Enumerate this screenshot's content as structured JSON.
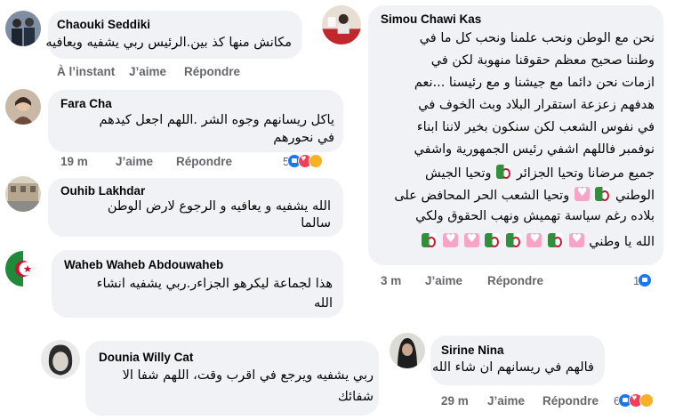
{
  "actions": {
    "like": "J’aime",
    "reply": "Répondre"
  },
  "comments": {
    "chaouki": {
      "author": "Chaouki Seddiki",
      "text": "مكانش منها كذ بين.الرئيس ربي يشفيه ويعافيه",
      "time": "À l’instant"
    },
    "fara": {
      "author": "Fara Cha",
      "lines": [
        "ياكل ريسانهم وجوه الشر .اللهم اجعل كيدهم",
        "في نحورهم"
      ],
      "time": "19 m",
      "reaction_count": "5",
      "reactions": [
        "like",
        "love",
        "care"
      ]
    },
    "ouhib": {
      "author": "Ouhib Lakhdar",
      "lines": [
        "الله يشفيه و يعافيه و الرجوع لارض الوطن",
        "سالما"
      ]
    },
    "waheb": {
      "author": "Waheb Waheb Abdouwaheb",
      "lines": [
        "هذا لجماعة  ليكرهو الجزاءر.ربي يشفيه انشاء",
        "الله"
      ]
    },
    "dounia": {
      "author": "Dounia Willy Cat",
      "lines": [
        "ربي يشفيه ويرجع في اقرب وقت، اللهم شفا الا",
        "شفائك"
      ]
    },
    "simou": {
      "author": "Simou Chawi Kas",
      "lines": [
        "نحن مع الوطن ونحب علمنا ونحب كل ما في",
        "وطننا صحيح معظم حقوقنا منهوبة لكن في",
        "ازمات نحن دائما مع جيشنا و مع رئيسنا ...نعم",
        "هدفهم زعزعة استقرار البلاد وبث الخوف في",
        "في نفوس الشعب لكن سنكون بخير لاننا ابناء",
        "نوفمبر فاللهم اشفي رئيس الجمهورية واشفي",
        "جميع مرضانا وتحيا الجزائر",
        "الوطني",
        "بلاده رغم سياسة تهميش ونهب الحقوق ولكي",
        "الله يا وطني"
      ],
      "line7_tail": "وتحيا الجيش",
      "line8_tail": "وتحيا الشعب الحر المحافض على",
      "time": "3 m",
      "reaction_count": "1",
      "reactions": [
        "like"
      ]
    },
    "sirine": {
      "author": "Sirine Nina",
      "text": "فالهم في ريسانهم ان شاء الله",
      "time": "29 m",
      "reaction_count": "6",
      "reactions": [
        "like",
        "love",
        "care"
      ]
    }
  },
  "colors": {
    "bubble": "#f0f2f5",
    "meta": "#65676b",
    "like_blue": "#1877f2",
    "love_red": "#f33e58"
  }
}
